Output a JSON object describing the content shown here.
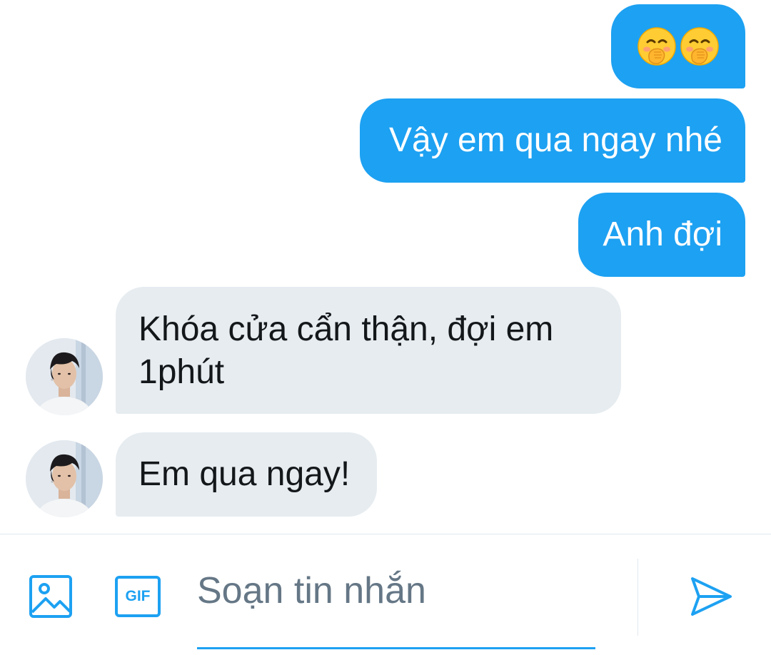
{
  "messages": [
    {
      "direction": "sent",
      "text": "🤭🤭",
      "emoji": [
        "face-with-hand-over-mouth",
        "face-with-hand-over-mouth"
      ]
    },
    {
      "direction": "sent",
      "text": "Vậy em qua ngay nhé"
    },
    {
      "direction": "sent",
      "text": "Anh đợi"
    },
    {
      "direction": "received",
      "lines": [
        "Khóa cửa cẩn thận, đợi em",
        "1phút"
      ]
    },
    {
      "direction": "received",
      "text": "Em qua ngay!"
    }
  ],
  "composer": {
    "placeholder": "Soạn tin nhắn",
    "value": "",
    "gif_label": "GIF",
    "icons": [
      "image-icon",
      "gif-icon",
      "send-icon"
    ]
  },
  "colors": {
    "accent": "#1da1f2",
    "received_bubble": "#e6ecf0",
    "received_text": "#14171a",
    "placeholder": "#657786",
    "divider": "#e1e8ed"
  }
}
